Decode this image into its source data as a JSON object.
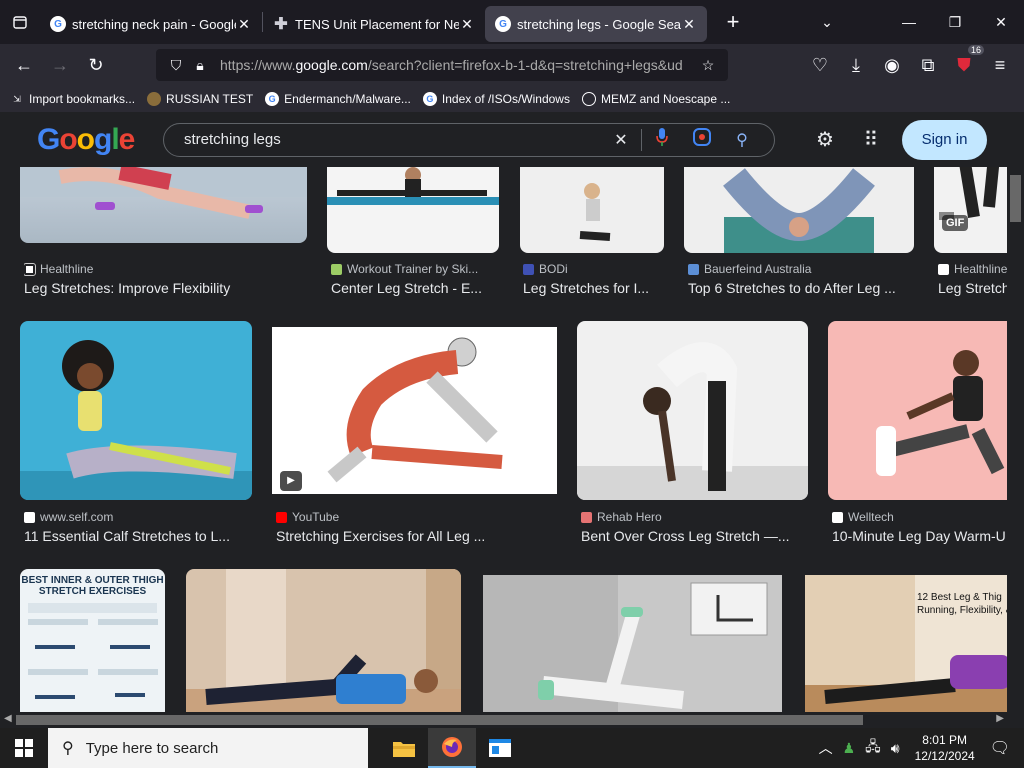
{
  "tabs": [
    {
      "title": "stretching neck pain - Google S",
      "icon": "google-icon"
    },
    {
      "title": "TENS Unit Placement for Neck",
      "icon": "cross-icon"
    },
    {
      "title": "stretching legs - Google Search",
      "icon": "google-icon"
    }
  ],
  "address": {
    "prefix": "https://www.",
    "host": "google.com",
    "path": "/search?client=firefox-b-1-d&q=stretching+legs&ud"
  },
  "extensions_badge": "16",
  "bookmarks": [
    {
      "label": "Import bookmarks...",
      "icon": "import-icon"
    },
    {
      "label": "RUSSIAN TEST",
      "icon": "mask-icon"
    },
    {
      "label": "Endermanch/Malware...",
      "icon": "google-icon"
    },
    {
      "label": "Index of /ISOs/Windows",
      "icon": "google-icon"
    },
    {
      "label": "MEMZ and Noescape ...",
      "icon": "globe-icon"
    }
  ],
  "google": {
    "logo": [
      "G",
      "o",
      "o",
      "g",
      "l",
      "e"
    ],
    "query": "stretching legs",
    "sign_in": "Sign in"
  },
  "results_row1": [
    {
      "source": "Healthline",
      "caption": "Leg Stretches: Improve Flexibility"
    },
    {
      "source": "Workout Trainer by Ski...",
      "caption": "Center Leg Stretch - E..."
    },
    {
      "source": "BODi",
      "caption": "Leg Stretches for I..."
    },
    {
      "source": "Bauerfeind Australia",
      "caption": "Top 6 Stretches to do After Leg ..."
    },
    {
      "source": "Healthline",
      "caption": "Leg Stretch",
      "badge": "GIF"
    }
  ],
  "results_row2": [
    {
      "source": "www.self.com",
      "caption": "11 Essential Calf Stretches to L..."
    },
    {
      "source": "YouTube",
      "caption": "Stretching Exercises for All Leg ..."
    },
    {
      "source": "Rehab Hero",
      "caption": "Bent Over Cross Leg Stretch —..."
    },
    {
      "source": "Welltech",
      "caption": "10-Minute Leg Day Warm-U"
    }
  ],
  "results_row3": [
    {
      "overlay_line1": "BEST INNER & OUTER THIGH",
      "overlay_line2": "STRETCH EXERCISES"
    },
    {},
    {},
    {
      "overlay_line1": "12 Best Leg & Thig",
      "overlay_line2": "Running, Flexibility, &"
    }
  ],
  "taskbar": {
    "search_placeholder": "Type here to search",
    "time": "8:01 PM",
    "date": "12/12/2024"
  }
}
